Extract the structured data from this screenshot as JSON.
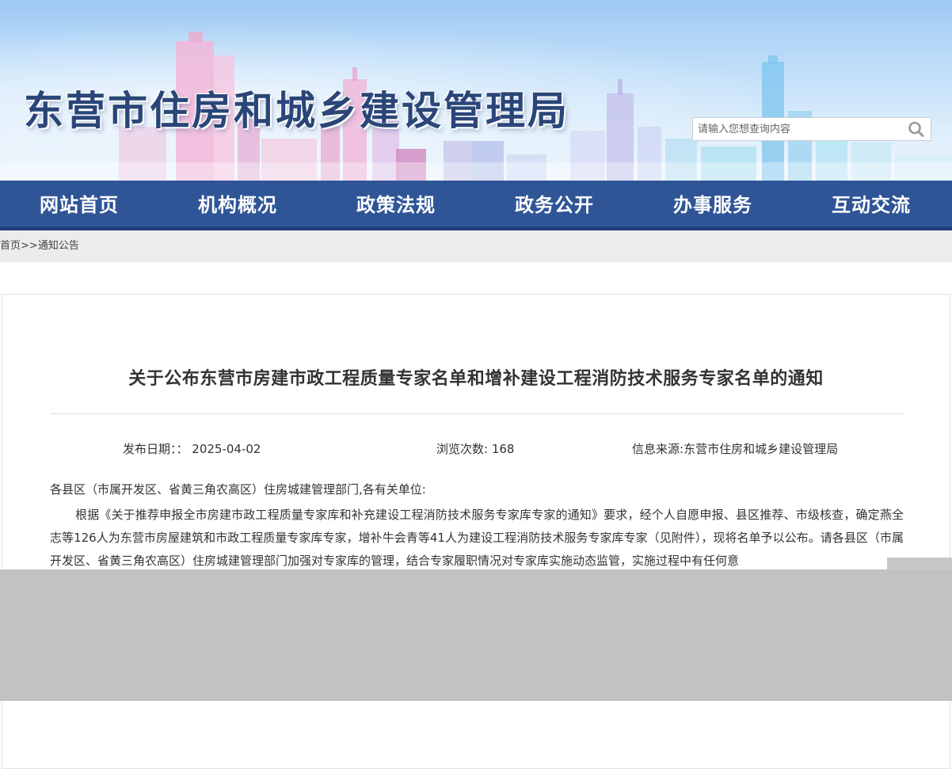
{
  "header": {
    "site_title": "东营市住房和城乡建设管理局",
    "search_placeholder": "请输入您想查询内容",
    "search_icon": "search-icon"
  },
  "nav": {
    "items": [
      {
        "label": "网站首页"
      },
      {
        "label": "机构概况"
      },
      {
        "label": "政策法规"
      },
      {
        "label": "政务公开"
      },
      {
        "label": "办事服务"
      },
      {
        "label": "互动交流"
      }
    ]
  },
  "breadcrumb": {
    "home": "首页",
    "separator": ">>",
    "current": "通知公告"
  },
  "article": {
    "title": "关于公布东营市房建市政工程质量专家名单和增补建设工程消防技术服务专家名单的通知",
    "publish_date_label": "发布日期：：",
    "publish_date": "2025-04-02",
    "views_label": "浏览次数:",
    "views": "168",
    "source_label": "信息来源:",
    "source": "东营市住房和城乡建设管理局",
    "salutation": "各县区（市属开发区、省黄三角农高区）住房城建管理部门,各有关单位:",
    "paragraph": "根据《关于推荐申报全市房建市政工程质量专家库和补充建设工程消防技术服务专家库专家的通知》要求，经个人自愿申报、县区推荐、市级核查，确定燕全志等126人为东营市房屋建筑和市政工程质量专家库专家，增补牛会青等41人为建设工程消防技术服务专家库专家（见附件），现将名单予以公布。请各县区（市属开发区、省黄三角农高区）住房城建管理部门加强对专家库的管理，结合专家履职情况对专家库实施动态监管，实施过程中有任何意"
  },
  "colors": {
    "nav_bg": "#2f5597",
    "nav_border": "#223f78",
    "title_text": "#2a4679",
    "breadcrumb_bg": "#ececec",
    "overlay": "#c3c1c1"
  }
}
